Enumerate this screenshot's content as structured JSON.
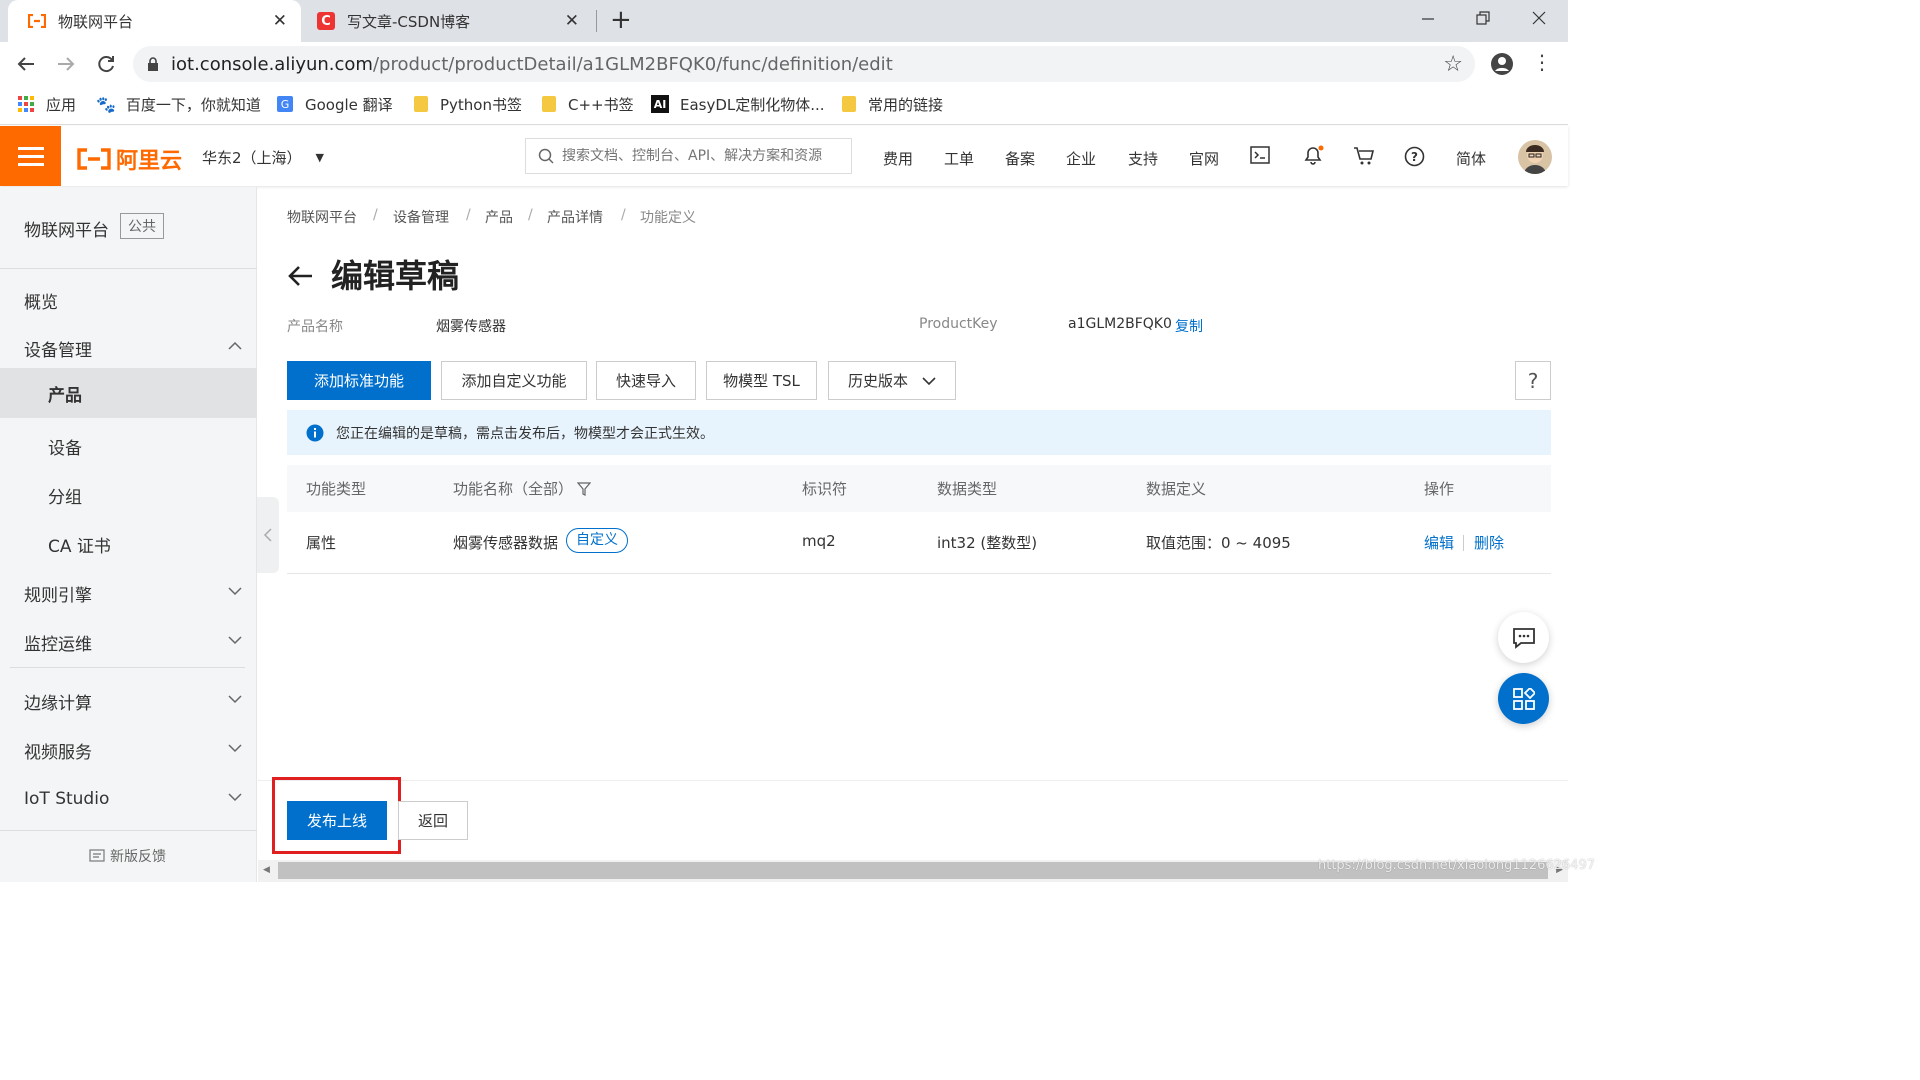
{
  "browser": {
    "tabs": [
      {
        "title": "物联网平台",
        "icon": "aliyun-favicon-icon"
      },
      {
        "title": "写文章-CSDN博客",
        "icon": "csdn-favicon-icon"
      }
    ],
    "new_tab": "+",
    "url_host": "iot.console.aliyun.com",
    "url_path": "/product/productDetail/a1GLM2BFQK0/func/definition/edit",
    "bookmarks": [
      {
        "label": "应用",
        "icon": "apps-grid-icon"
      },
      {
        "label": "百度一下，你就知道",
        "icon": "baidu-paw-icon"
      },
      {
        "label": "Google 翻译",
        "icon": "google-translate-icon"
      },
      {
        "label": "Python书签",
        "icon": "folder-icon"
      },
      {
        "label": "C++书签",
        "icon": "folder-icon"
      },
      {
        "label": "EasyDL定制化物体...",
        "icon": "ai-logo-icon"
      },
      {
        "label": "常用的链接",
        "icon": "folder-icon"
      }
    ]
  },
  "topbar": {
    "brand": "阿里云",
    "region": "华东2（上海）",
    "search_placeholder": "搜索文档、控制台、API、解决方案和资源",
    "links": [
      "费用",
      "工单",
      "备案",
      "企业",
      "支持",
      "官网"
    ],
    "lang": "简体"
  },
  "sidebar": {
    "title": "物联网平台",
    "badge": "公共",
    "items": [
      {
        "label": "概览"
      },
      {
        "label": "设备管理"
      },
      {
        "label": "产品"
      },
      {
        "label": "设备"
      },
      {
        "label": "分组"
      },
      {
        "label": "CA 证书"
      },
      {
        "label": "规则引擎"
      },
      {
        "label": "监控运维"
      },
      {
        "label": "边缘计算"
      },
      {
        "label": "视频服务"
      },
      {
        "label": "IoT Studio"
      }
    ],
    "feedback": "新版反馈"
  },
  "breadcrumb": [
    "物联网平台",
    "设备管理",
    "产品",
    "产品详情",
    "功能定义"
  ],
  "page": {
    "title": "编辑草稿",
    "product_name_label": "产品名称",
    "product_name": "烟雾传感器",
    "product_key_label": "ProductKey",
    "product_key": "a1GLM2BFQK0",
    "copy": "复制"
  },
  "actions": {
    "add_standard": "添加标准功能",
    "add_custom": "添加自定义功能",
    "quick_import": "快速导入",
    "tsl": "物模型 TSL",
    "history": "历史版本",
    "help": "?"
  },
  "notice": "您正在编辑的是草稿，需点击发布后，物模型才会正式生效。",
  "table": {
    "headers": [
      "功能类型",
      "功能名称（全部）",
      "标识符",
      "数据类型",
      "数据定义",
      "操作"
    ],
    "rows": [
      {
        "type": "属性",
        "name": "烟雾传感器数据",
        "tag": "自定义",
        "identifier": "mq2",
        "data_type": "int32 (整数型)",
        "definition": "取值范围：0 ~ 4095",
        "edit": "编辑",
        "delete": "删除"
      }
    ]
  },
  "footer": {
    "publish": "发布上线",
    "back": "返回"
  },
  "watermark": "https://blog.csdn.net/xiaolong1126626497",
  "colors": {
    "accent": "#0070cc",
    "brand_orange": "#ff6a00",
    "highlight_box": "#e02020"
  }
}
